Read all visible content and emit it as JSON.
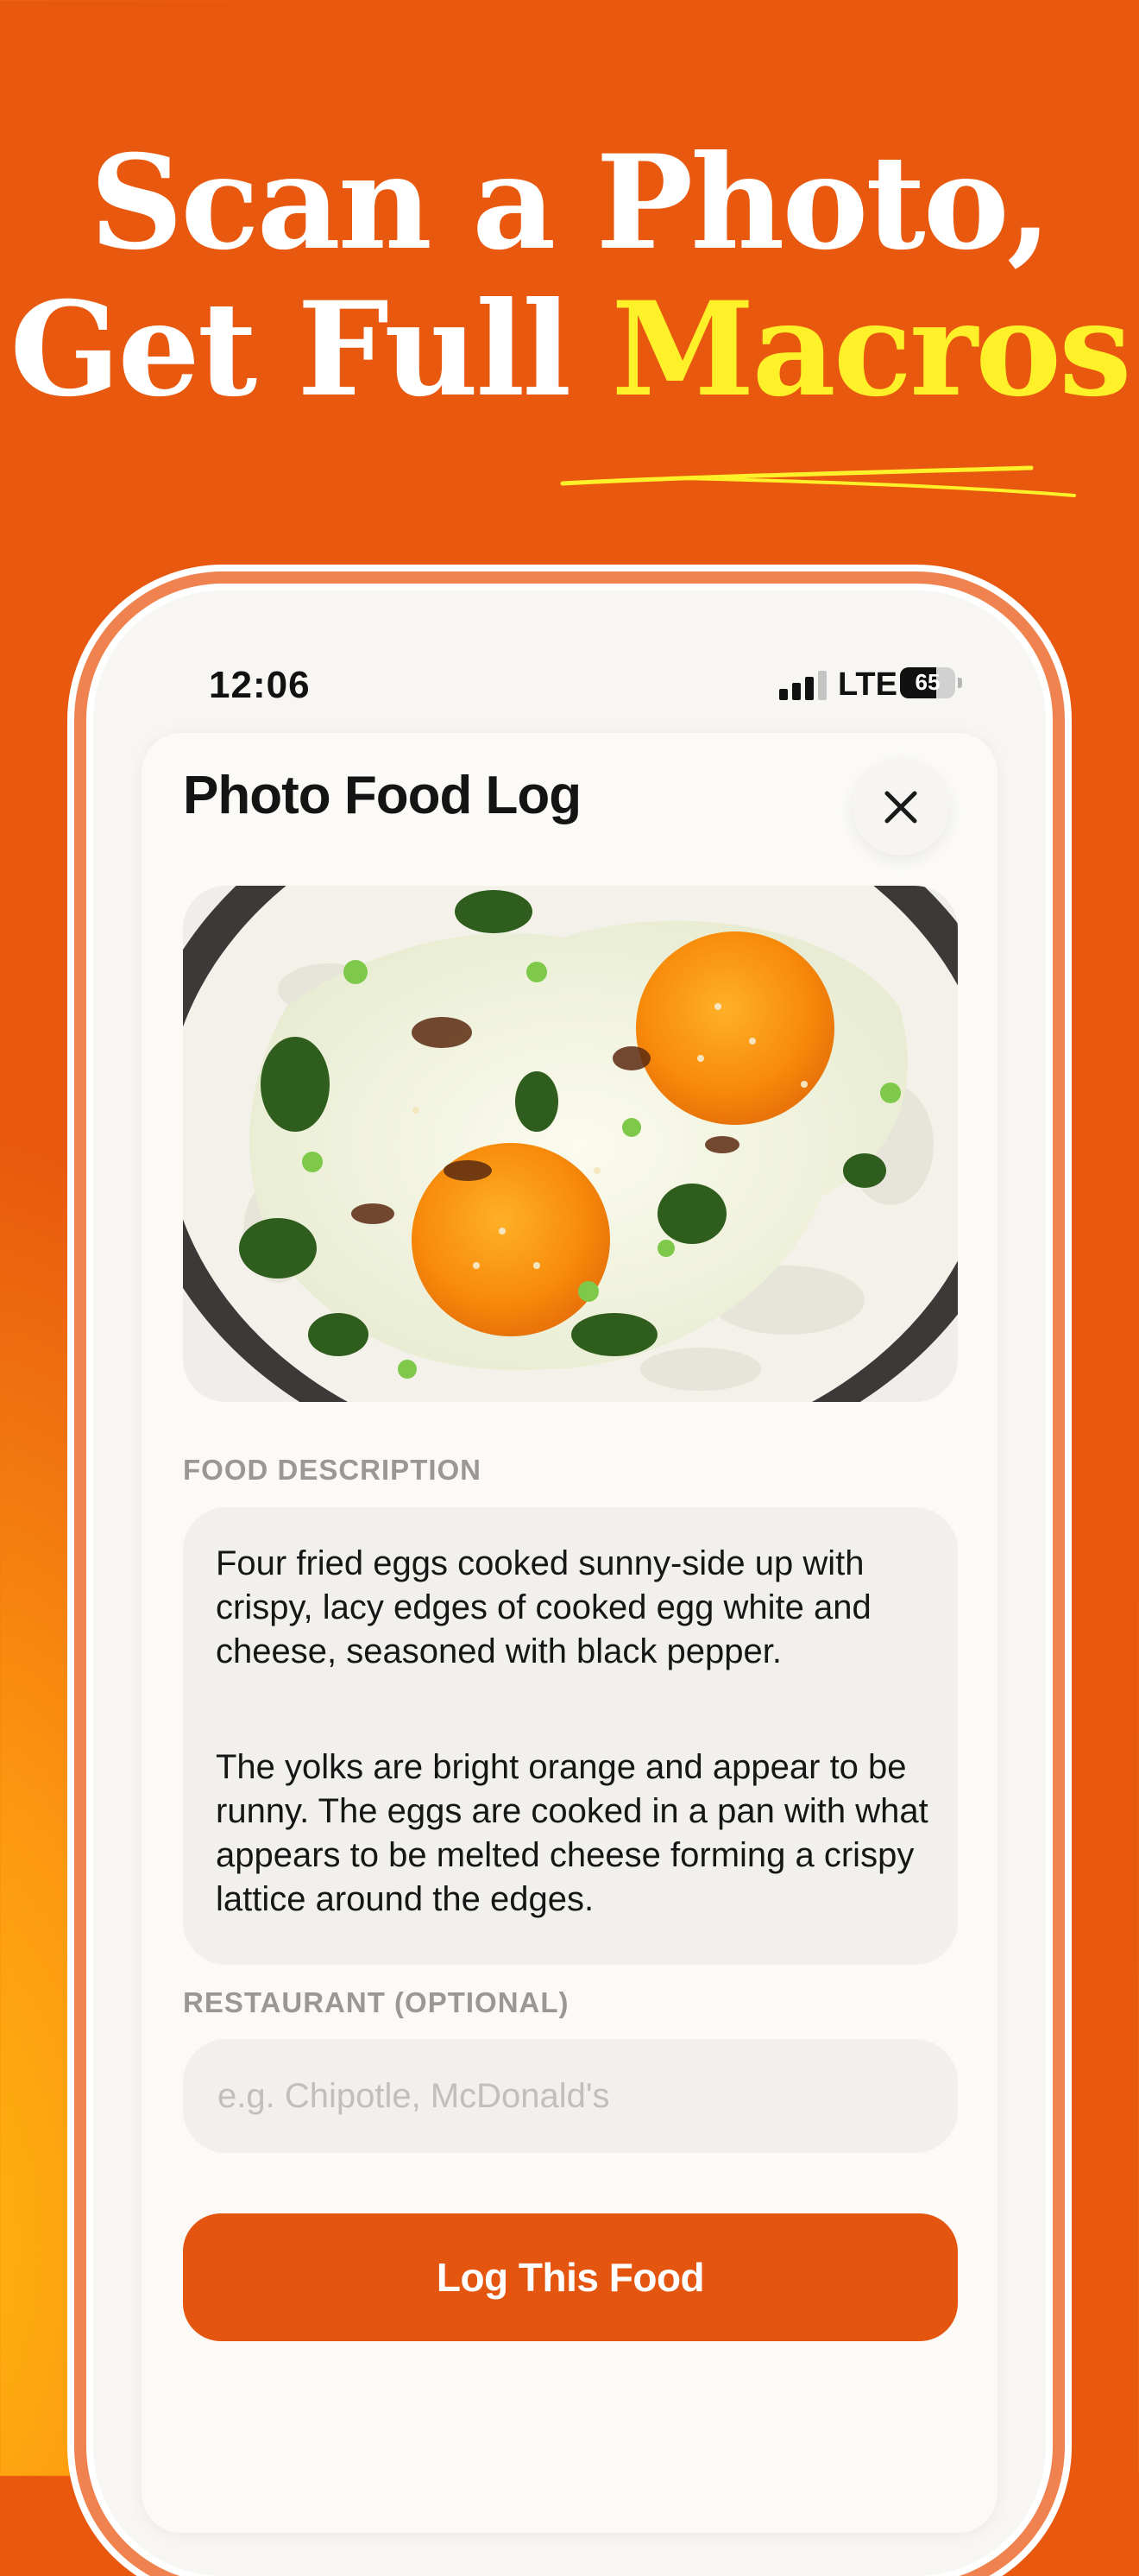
{
  "headline": {
    "line1": "Scan a Photo,",
    "line2_prefix": "Get Full",
    "line2_highlight": "Macros"
  },
  "status_bar": {
    "time": "12:06",
    "network": "LTE",
    "battery": "65",
    "battery_level": 0.65
  },
  "screen": {
    "title": "Photo Food Log",
    "close_icon": "close-icon",
    "photo_alt": "Fried eggs over rice with scallions, sesame seeds and soy sauce"
  },
  "description": {
    "label": "FOOD DESCRIPTION",
    "paragraph1": "Four fried eggs cooked sunny-side up with crispy, lacy edges of cooked egg white and cheese, seasoned with black pepper.",
    "paragraph2": "The yolks are bright orange and appear to be runny. The eggs are cooked in a pan with what appears to be melted cheese forming a crispy lattice around the edges."
  },
  "restaurant": {
    "label": "RESTAURANT (OPTIONAL)",
    "placeholder": "e.g. Chipotle, McDonald's",
    "value": ""
  },
  "cta": {
    "label": "Log This Food"
  },
  "colors": {
    "background": "#e8580e",
    "highlight": "#fff129",
    "accent_button": "#e4560f",
    "sheet": "#fbfaf7"
  }
}
